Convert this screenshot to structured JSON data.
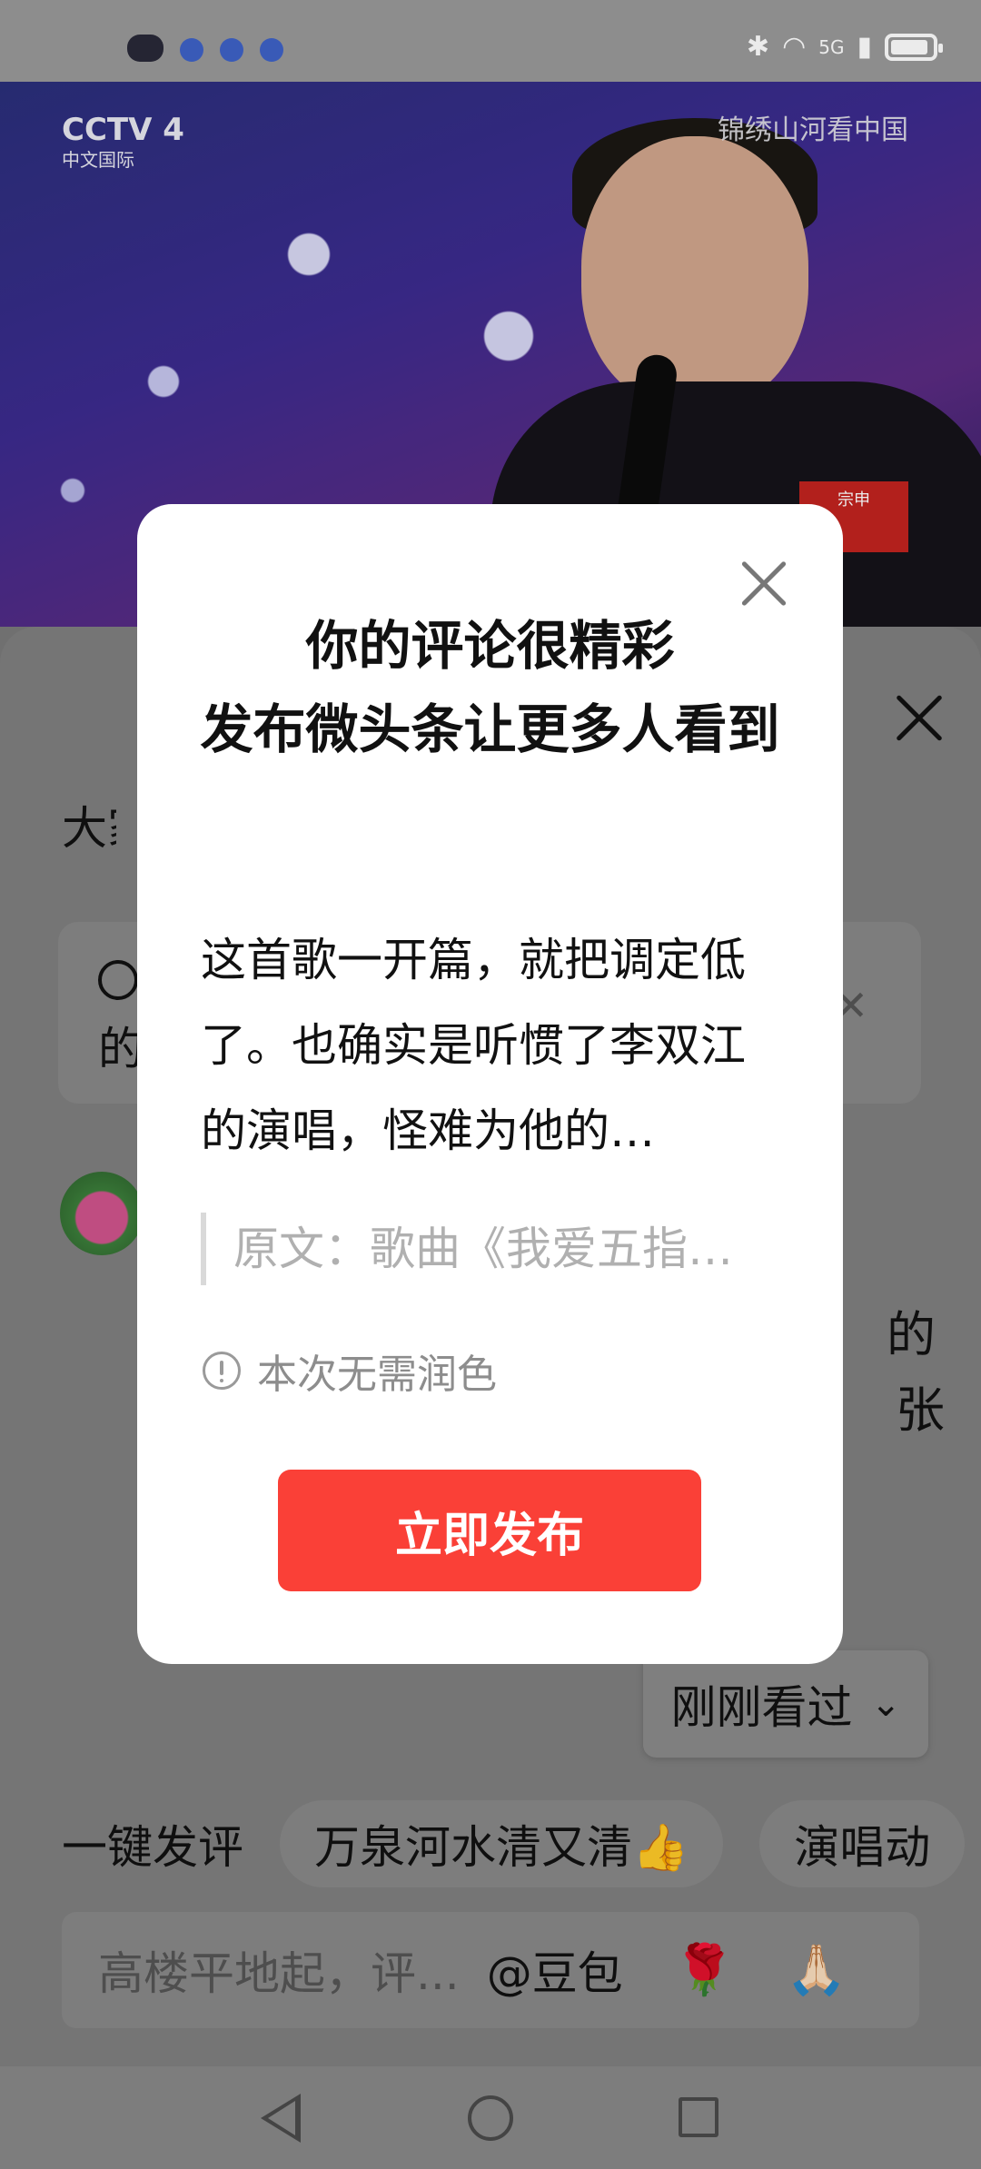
{
  "status_bar": {
    "network": "5G",
    "icons": [
      "bluetooth-icon",
      "wifi-icon",
      "signal-icon",
      "battery-icon"
    ]
  },
  "video": {
    "channel_logo": "CCTV 4",
    "channel_subtitle": "中文国际",
    "watermark": "锦绣山河看中国",
    "sponsor": "宗申"
  },
  "comments_sheet": {
    "title_partial": "大家",
    "tip_text_partial": "的",
    "comment_fragment_1": "的",
    "comment_fragment_2": "张",
    "recently_viewed_label": "刚刚看过",
    "quick_comment_label": "一键发评",
    "quick_chips": [
      "万泉河水清又清👍",
      "演唱动"
    ],
    "input_placeholder": "高楼平地起，评...",
    "input_mention": "@豆包",
    "emojis": [
      "🌹",
      "🙏🏻"
    ]
  },
  "modal": {
    "title_line1": "你的评论很精彩",
    "title_line2": "发布微头条让更多人看到",
    "comment_text": "这首歌一开篇，就把调定低了。也确实是听惯了李双江的演唱，怪难为他的…",
    "original_quote": "原文：歌曲《我爱五指…",
    "notice": "本次无需润色",
    "publish_button": "立即发布"
  },
  "colors": {
    "primary_button": "#fa4037",
    "modal_background": "#ffffff",
    "notice_text": "#8d8d8d"
  }
}
